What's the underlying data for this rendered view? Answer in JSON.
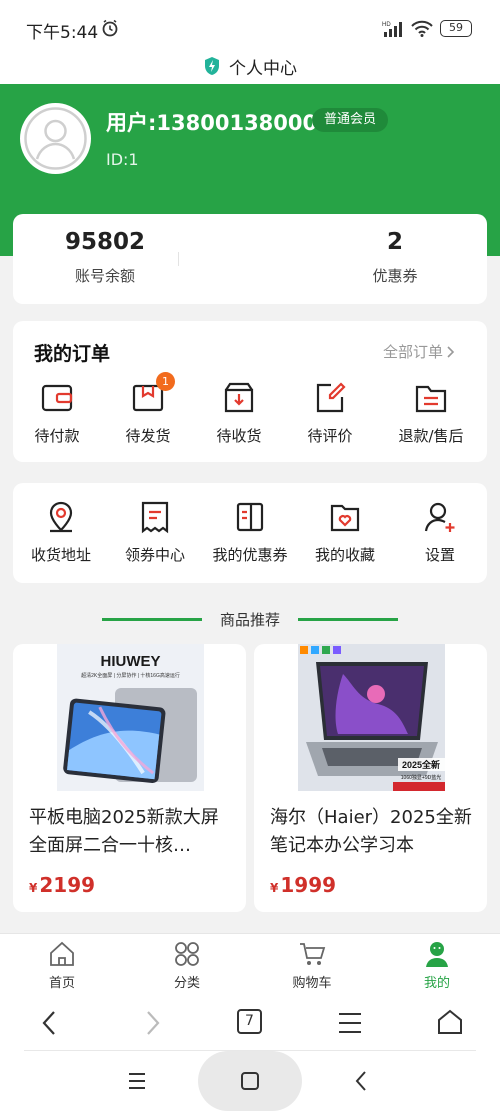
{
  "status_bar": {
    "time": "下午5:44",
    "battery": "59",
    "signal_label": "HD"
  },
  "header": {
    "title": "个人中心"
  },
  "user": {
    "name": "用户:13800138000",
    "member_badge": "普通会员",
    "id": "ID:1"
  },
  "stats": [
    {
      "value": "95802",
      "label": "账号余额"
    },
    {
      "value": "2",
      "label": "优惠券"
    }
  ],
  "orders": {
    "title": "我的订单",
    "view_all": "全部订单",
    "items": [
      {
        "label": "待付款",
        "icon": "wallet-icon"
      },
      {
        "label": "待发货",
        "icon": "package-icon",
        "badge": "1"
      },
      {
        "label": "待收货",
        "icon": "delivery-box-icon"
      },
      {
        "label": "待评价",
        "icon": "review-edit-icon"
      },
      {
        "label": "退款/售后",
        "icon": "refund-folder-icon"
      }
    ]
  },
  "services": [
    {
      "label": "收货地址",
      "icon": "location-pin-icon"
    },
    {
      "label": "领券中心",
      "icon": "coupon-receipt-icon"
    },
    {
      "label": "我的优惠券",
      "icon": "coupon-book-icon"
    },
    {
      "label": "我的收藏",
      "icon": "heart-folder-icon"
    },
    {
      "label": "设置",
      "icon": "user-settings-icon"
    }
  ],
  "recommend": {
    "section_title": "商品推荐",
    "products": [
      {
        "name": "平板电脑2025新款大屏全面屏二合一十核…",
        "currency": "¥",
        "price": "2199",
        "image_brand": "HIUWEY",
        "image_tagline": "超清2K全面屏 | 分屏协作 | 十核16G高速运行"
      },
      {
        "name": "海尔（Haier）2025全新笔记本办公学习本",
        "currency": "¥",
        "price": "1999",
        "image_badge": "2025全新",
        "image_sub": "1060独显+9D蓝光"
      }
    ]
  },
  "tabbar": [
    {
      "label": "首页",
      "icon": "home-icon",
      "active": false
    },
    {
      "label": "分类",
      "icon": "category-grid-icon",
      "active": false
    },
    {
      "label": "购物车",
      "icon": "cart-icon",
      "active": false
    },
    {
      "label": "我的",
      "icon": "profile-icon",
      "active": true
    }
  ],
  "browser_bar": {
    "tab_count": "7"
  },
  "colors": {
    "primary": "#27a346",
    "price": "#d0302a",
    "badge": "#f26b1d"
  }
}
